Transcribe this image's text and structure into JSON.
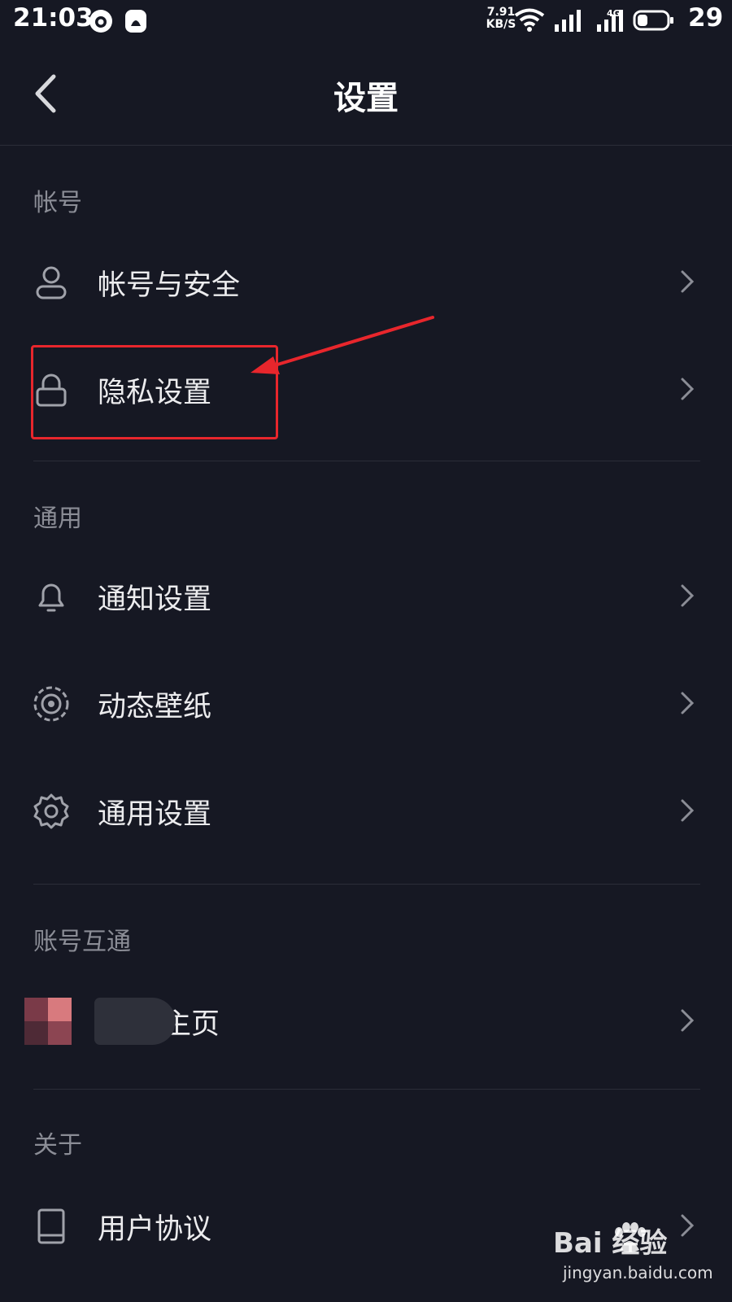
{
  "status_bar": {
    "time": "21:03",
    "speed_value": "7.91",
    "speed_unit": "KB/S",
    "network": "4G",
    "battery": "29",
    "icons": [
      "app-notification-icon",
      "qq-icon",
      "wifi-icon",
      "signal-icon",
      "signal-4g-icon",
      "battery-icon"
    ]
  },
  "header": {
    "title": "设置",
    "back_icon": "chevron-left-icon"
  },
  "sections": {
    "account": {
      "title": "帐号",
      "items": [
        {
          "label": "帐号与安全",
          "icon": "user-icon"
        },
        {
          "label": "隐私设置",
          "icon": "lock-icon"
        }
      ]
    },
    "general": {
      "title": "通用",
      "items": [
        {
          "label": "通知设置",
          "icon": "bell-icon"
        },
        {
          "label": "动态壁纸",
          "icon": "live-wallpaper-icon"
        },
        {
          "label": "通用设置",
          "icon": "gear-icon"
        }
      ]
    },
    "linked": {
      "title": "账号互通",
      "items": [
        {
          "label": "主页",
          "icon": "blurred-avatar"
        }
      ]
    },
    "about": {
      "title": "关于",
      "items": [
        {
          "label": "用户协议",
          "icon": "book-icon"
        }
      ]
    }
  },
  "annotation": {
    "color": "#e8262c",
    "target": "隐私设置"
  },
  "watermark": {
    "brand": "Bai  经验",
    "site": "jingyan.baidu.com"
  },
  "colors": {
    "background": "#161823",
    "text": "#ececee",
    "section_text": "#8b8d96",
    "divider": "#2b2d38",
    "annotation_red": "#e8262c"
  }
}
